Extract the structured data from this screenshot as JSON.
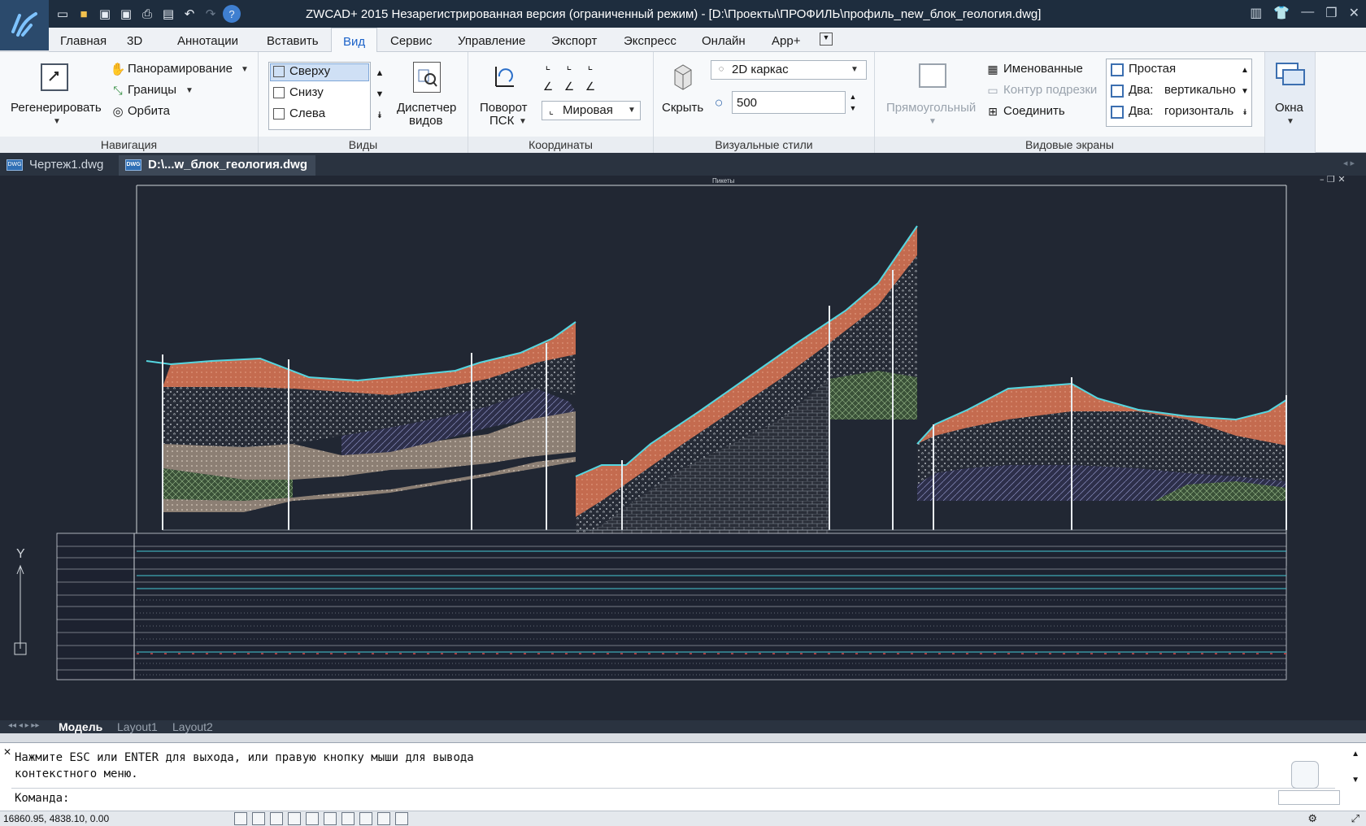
{
  "title": "ZWCAD+ 2015 Незарегистрированная версия (ограниченный режим) - [D:\\Проекты\\ПРОФИЛЬ\\профиль_new_блок_геология.dwg]",
  "ribbon_tabs": [
    "Главная",
    "3D",
    "Аннотации",
    "Вставить",
    "Вид",
    "Сервис",
    "Управление",
    "Экспорт",
    "Экспресс",
    "Онлайн",
    "App+"
  ],
  "active_tab": "Вид",
  "nav": {
    "regen": "Регенерировать",
    "pan": "Панорамирование",
    "bounds": "Границы",
    "orbit": "Орбита",
    "title": "Навигация"
  },
  "views": {
    "items": [
      "Сверху",
      "Снизу",
      "Слева"
    ],
    "manager_1": "Диспетчер",
    "manager_2": "видов",
    "title": "Виды"
  },
  "coords": {
    "rotate_1": "Поворот",
    "rotate_2": "ПСК",
    "world": "Мировая",
    "title": "Координаты"
  },
  "visual": {
    "hide": "Скрыть",
    "style": "2D каркас",
    "value": "500",
    "title": "Визуальные стили"
  },
  "viewports": {
    "rect": "Прямоугольный",
    "named": "Именованные",
    "clip": "Контур подрезки",
    "join": "Соединить",
    "simple": "Простая",
    "two": "Два:",
    "vertical": "вертикально",
    "horizontal": "горизонталь",
    "title": "Видовые экраны"
  },
  "windows": {
    "label": "Окна"
  },
  "doc_tabs": [
    "Чертеж1.dwg",
    "D:\\...w_блок_геология.dwg"
  ],
  "layout_tabs": [
    "Модель",
    "Layout1",
    "Layout2"
  ],
  "drawing": {
    "header": "Пикеты",
    "y_axis_label": "Y"
  },
  "command": {
    "line1": "Нажмите ESC или ENTER для выхода, или правую кнопку мыши для вывода",
    "line2": "контекстного меню.",
    "prompt": "Команда:"
  },
  "status": {
    "coords": "16860.95, 4838.10, 0.00"
  },
  "colors": {
    "titlebar": "#1e2d3e",
    "canvas": "#212733",
    "accent": "#1c63c9",
    "soil_orange": "#c8674a",
    "cyan": "#4fd1dc"
  }
}
